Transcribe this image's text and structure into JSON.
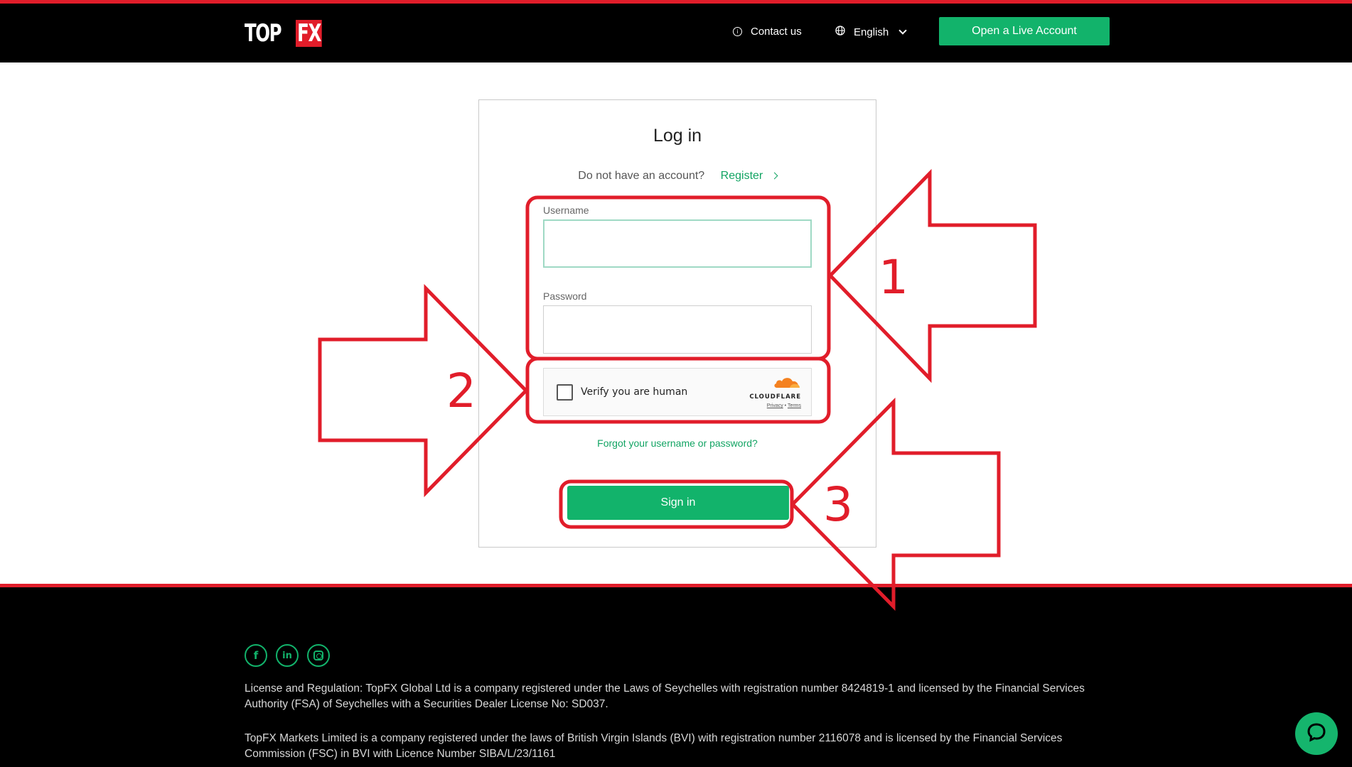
{
  "header": {
    "logo_top": "TOP",
    "logo_fx": "FX",
    "contact_label": "Contact us",
    "language_label": "English",
    "live_account_label": "Open a Live Account"
  },
  "login": {
    "title": "Log in",
    "no_account_text": "Do not have an account?",
    "register_label": "Register",
    "username_label": "Username",
    "username_value": "",
    "password_label": "Password",
    "password_value": "",
    "captcha_text": "Verify you are human",
    "captcha_brand": "CLOUDFLARE",
    "captcha_privacy": "Privacy",
    "captcha_terms": "Terms",
    "forgot_label": "Forgot your username or password?",
    "signin_label": "Sign in"
  },
  "annotations": {
    "step1": "1",
    "step2": "2",
    "step3": "3",
    "color": "#e11d2a"
  },
  "footer": {
    "legal_1": "License and Regulation: TopFX Global Ltd is a company registered under the Laws of Seychelles with registration number 8424819-1 and licensed by the Financial Services Authority (FSA) of Seychelles with a Securities Dealer License No: SD037.",
    "legal_2": "TopFX Markets Limited is a company registered under the laws of British Virgin Islands (BVI) with registration number 2116078 and is licensed by the Financial Services Commission (FSC) in BVI with Licence Number SIBA/L/23/1161",
    "social_icons": [
      "facebook-icon",
      "linkedin-icon",
      "instagram-icon"
    ]
  },
  "colors": {
    "brand_green": "#12b36b",
    "brand_red": "#e11d2a",
    "header_bg": "#000000"
  }
}
